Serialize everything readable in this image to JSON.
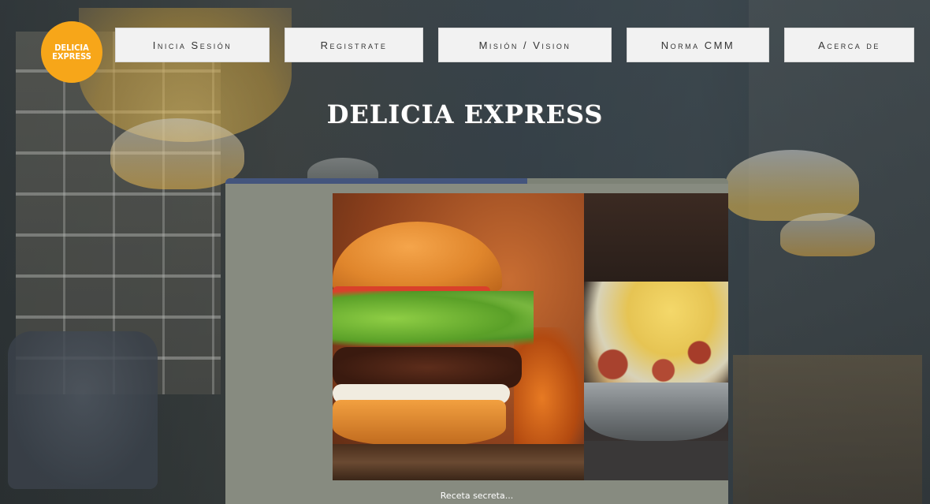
{
  "brand": {
    "logo_line1": "DELICIA",
    "logo_line2": "EXPRESS",
    "logo_color": "#f7a619"
  },
  "nav": {
    "items": [
      {
        "label": "Inicia Sesión"
      },
      {
        "label": "Registrate"
      },
      {
        "label": "Misión / Vision"
      },
      {
        "label": "Norma CMM"
      },
      {
        "label": "Acerca de"
      }
    ]
  },
  "hero": {
    "title": "DELICIA EXPRESS"
  },
  "carousel": {
    "progress_fraction": 0.6,
    "progress_color": "#44557d",
    "caption": "Receta secreta...",
    "images": [
      {
        "icon": "burger-image"
      },
      {
        "icon": "dish-image"
      }
    ]
  }
}
